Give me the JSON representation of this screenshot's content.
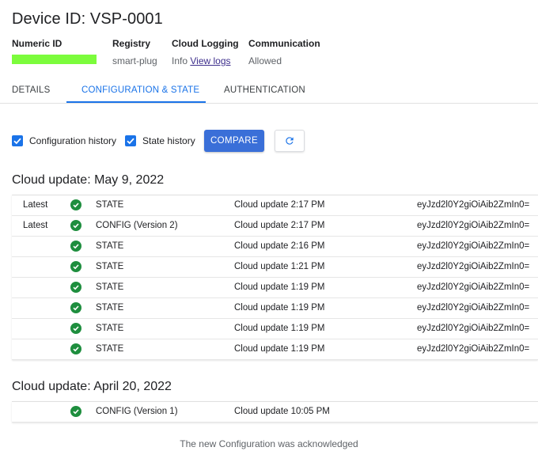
{
  "device": {
    "title": "Device ID: VSP-0001",
    "meta": {
      "numeric_id_label": "Numeric ID",
      "numeric_id_value_color": "#7cfc3c",
      "registry_label": "Registry",
      "registry_value": "smart-plug",
      "logging_label": "Cloud Logging",
      "logging_value_prefix": "Info",
      "logging_link": "View logs",
      "communication_label": "Communication",
      "communication_value": "Allowed"
    }
  },
  "tabs": {
    "details": "DETAILS",
    "config_state": "CONFIGURATION & STATE",
    "authentication": "AUTHENTICATION",
    "active": "config_state"
  },
  "toolbar": {
    "config_history_label": "Configuration history",
    "config_history_checked": true,
    "state_history_label": "State history",
    "state_history_checked": true,
    "compare_label": "COMPARE",
    "refresh_icon": "refresh-icon"
  },
  "groups": [
    {
      "title": "Cloud update: May 9, 2022",
      "rows": [
        {
          "tag": "Latest",
          "type": "STATE",
          "time": "Cloud update 2:17 PM",
          "hash": "eyJzd2l0Y2giOiAib2ZmIn0="
        },
        {
          "tag": "Latest",
          "type": "CONFIG (Version 2)",
          "time": "Cloud update 2:17 PM",
          "hash": "eyJzd2l0Y2giOiAib2ZmIn0="
        },
        {
          "tag": "",
          "type": "STATE",
          "time": "Cloud update 2:16 PM",
          "hash": "eyJzd2l0Y2giOiAib2ZmIn0="
        },
        {
          "tag": "",
          "type": "STATE",
          "time": "Cloud update 1:21 PM",
          "hash": "eyJzd2l0Y2giOiAib2ZmIn0="
        },
        {
          "tag": "",
          "type": "STATE",
          "time": "Cloud update 1:19 PM",
          "hash": "eyJzd2l0Y2giOiAib2ZmIn0="
        },
        {
          "tag": "",
          "type": "STATE",
          "time": "Cloud update 1:19 PM",
          "hash": "eyJzd2l0Y2giOiAib2ZmIn0="
        },
        {
          "tag": "",
          "type": "STATE",
          "time": "Cloud update 1:19 PM",
          "hash": "eyJzd2l0Y2giOiAib2ZmIn0="
        },
        {
          "tag": "",
          "type": "STATE",
          "time": "Cloud update 1:19 PM",
          "hash": "eyJzd2l0Y2giOiAib2ZmIn0="
        }
      ]
    },
    {
      "title": "Cloud update: April 20, 2022",
      "rows": [
        {
          "tag": "",
          "type": "CONFIG (Version 1)",
          "time": "Cloud update 10:05 PM",
          "hash": ""
        }
      ]
    }
  ],
  "status_icon": "check-circle-icon",
  "footer_note": "The new Configuration was acknowledged"
}
